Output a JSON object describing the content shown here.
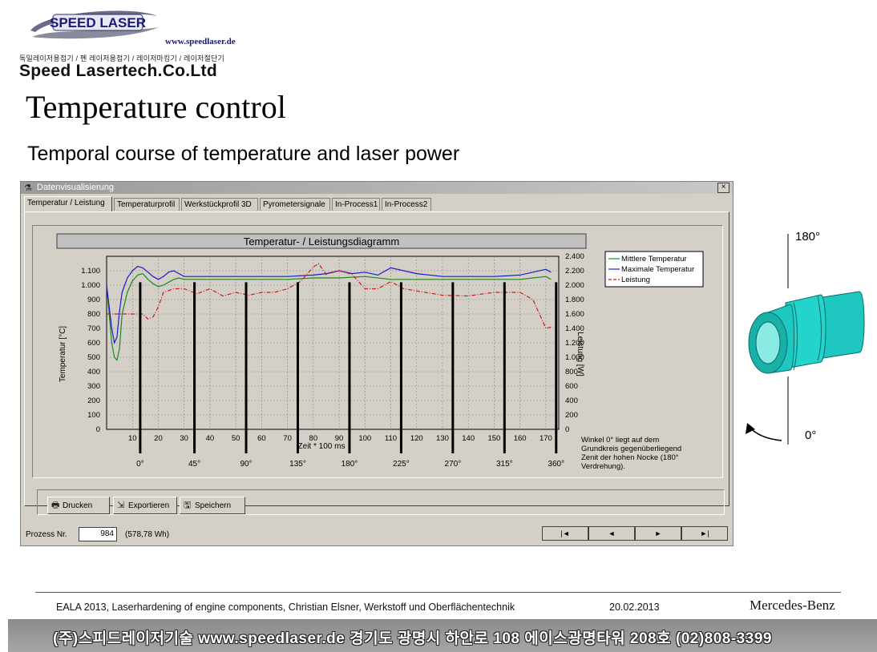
{
  "header": {
    "logo_text": "SPEED LASER",
    "website": "www.speedlaser.de",
    "korean_tagline": "독일레이저용접기 / 펜 레이저용접기 / 레이저마킹기 / 레이저절단기",
    "company_name": "Speed Lasertech.Co.Ltd"
  },
  "slide": {
    "title": "Temperature control",
    "subtitle": "Temporal course of temperature and laser power"
  },
  "window": {
    "title": "Datenvisualisierung",
    "close_label": "×",
    "tabs": [
      {
        "label": "Temperatur / Leistung",
        "active": true
      },
      {
        "label": "Temperaturprofil",
        "active": false
      },
      {
        "label": "Werkstückprofil 3D",
        "active": false
      },
      {
        "label": "Pyrometersignale",
        "active": false
      },
      {
        "label": "In-Process1",
        "active": false
      },
      {
        "label": "In-Process2",
        "active": false
      }
    ],
    "buttons": {
      "print": "Drucken",
      "export": "Exportieren",
      "save": "Speichern"
    },
    "status": {
      "prozess_label": "Prozess Nr.",
      "prozess_value": "984",
      "energy": "(578,78 Wh)",
      "nav": [
        "|◄",
        "◄",
        "►",
        "►|"
      ]
    }
  },
  "chart_data": {
    "type": "line",
    "title": "Temperatur- / Leistungsdiagramm",
    "xlabel": "Zeit * 100 ms",
    "ylabel": "Temperatur [°C]",
    "y2label": "Leistung [W]",
    "xlim": [
      0,
      175
    ],
    "ylim": [
      0,
      1200
    ],
    "y2lim": [
      0,
      2400
    ],
    "x_ticks": [
      10,
      20,
      30,
      40,
      50,
      60,
      70,
      80,
      90,
      100,
      110,
      120,
      130,
      140,
      150,
      160,
      170
    ],
    "y_tick_labels": [
      "0",
      "100",
      "200",
      "300",
      "400",
      "500",
      "600",
      "700",
      "800",
      "900",
      "1.000",
      "1.100"
    ],
    "y2_tick_labels": [
      "0",
      "200",
      "400",
      "600",
      "800",
      "1.000",
      "1.200",
      "1.400",
      "1.600",
      "1.800",
      "2.000",
      "2.200",
      "2.400"
    ],
    "grid": true,
    "legend_position": "top-right",
    "series": [
      {
        "name": "Mittlere Temperatur",
        "color": "#1a8a1a",
        "axis": "left",
        "x": [
          0,
          2,
          3,
          4,
          5,
          6,
          8,
          10,
          12,
          14,
          16,
          18,
          20,
          22,
          24,
          26,
          28,
          30,
          40,
          50,
          60,
          70,
          80,
          90,
          100,
          110,
          120,
          130,
          140,
          150,
          160,
          165,
          170,
          172
        ],
        "y": [
          1000,
          600,
          500,
          480,
          560,
          800,
          950,
          1030,
          1070,
          1080,
          1040,
          1010,
          990,
          1000,
          1020,
          1040,
          1050,
          1040,
          1040,
          1040,
          1040,
          1040,
          1050,
          1050,
          1060,
          1040,
          1040,
          1040,
          1040,
          1040,
          1040,
          1050,
          1060,
          1040
        ]
      },
      {
        "name": "Maximale Temperatur",
        "color": "#1a1acc",
        "axis": "left",
        "x": [
          0,
          2,
          3,
          4,
          5,
          6,
          8,
          10,
          12,
          14,
          16,
          18,
          20,
          22,
          24,
          26,
          28,
          30,
          40,
          50,
          60,
          70,
          80,
          85,
          90,
          95,
          100,
          105,
          110,
          115,
          120,
          130,
          140,
          150,
          160,
          165,
          170,
          172
        ],
        "y": [
          1000,
          700,
          600,
          640,
          820,
          950,
          1050,
          1100,
          1130,
          1120,
          1090,
          1060,
          1040,
          1060,
          1090,
          1100,
          1080,
          1060,
          1060,
          1060,
          1060,
          1060,
          1070,
          1080,
          1100,
          1080,
          1090,
          1070,
          1120,
          1100,
          1080,
          1060,
          1060,
          1060,
          1070,
          1090,
          1110,
          1090
        ]
      },
      {
        "name": "Leistung",
        "color": "#cc1a1a",
        "axis": "right",
        "x": [
          0,
          5,
          10,
          14,
          16,
          18,
          20,
          22,
          26,
          30,
          35,
          40,
          45,
          50,
          55,
          60,
          65,
          70,
          75,
          80,
          82,
          85,
          90,
          95,
          100,
          105,
          110,
          115,
          120,
          130,
          140,
          150,
          160,
          165,
          170,
          172
        ],
        "y": [
          1600,
          1600,
          1600,
          1600,
          1530,
          1560,
          1700,
          1900,
          1950,
          1950,
          1880,
          1950,
          1850,
          1900,
          1860,
          1900,
          1900,
          1950,
          2050,
          2250,
          2300,
          2150,
          2200,
          2150,
          1950,
          1950,
          2050,
          1950,
          1920,
          1860,
          1850,
          1900,
          1900,
          1800,
          1400,
          1420
        ]
      }
    ],
    "angle_markers": [
      {
        "x": 13,
        "label": "0°"
      },
      {
        "x": 34,
        "label": "45°"
      },
      {
        "x": 54,
        "label": "90°"
      },
      {
        "x": 74,
        "label": "135°"
      },
      {
        "x": 94,
        "label": "180°"
      },
      {
        "x": 114,
        "label": "225°"
      },
      {
        "x": 134,
        "label": "270°"
      },
      {
        "x": 154,
        "label": "315°"
      },
      {
        "x": 174,
        "label": "360°"
      }
    ],
    "annotation": "Winkel 0° liegt auf dem Grundkreis gegenüberliegend Zenit der hohen Nocke (180° Verdrehung)."
  },
  "part_diagram": {
    "top_label": "180°",
    "bottom_label": "0°",
    "part_color": "#1ec8c0"
  },
  "footer": {
    "citation": "EALA 2013, Laserhardening  of engine components, Christian Elsner, Werkstoff und Oberflächentechnik",
    "date": "20.02.2013",
    "brand": "Mercedes-Benz",
    "band_text": "(주)스피드레이저기술  www.speedlaser.de   경기도 광명시 하안로 108 에이스광명타워 208호 (02)808-3399"
  }
}
